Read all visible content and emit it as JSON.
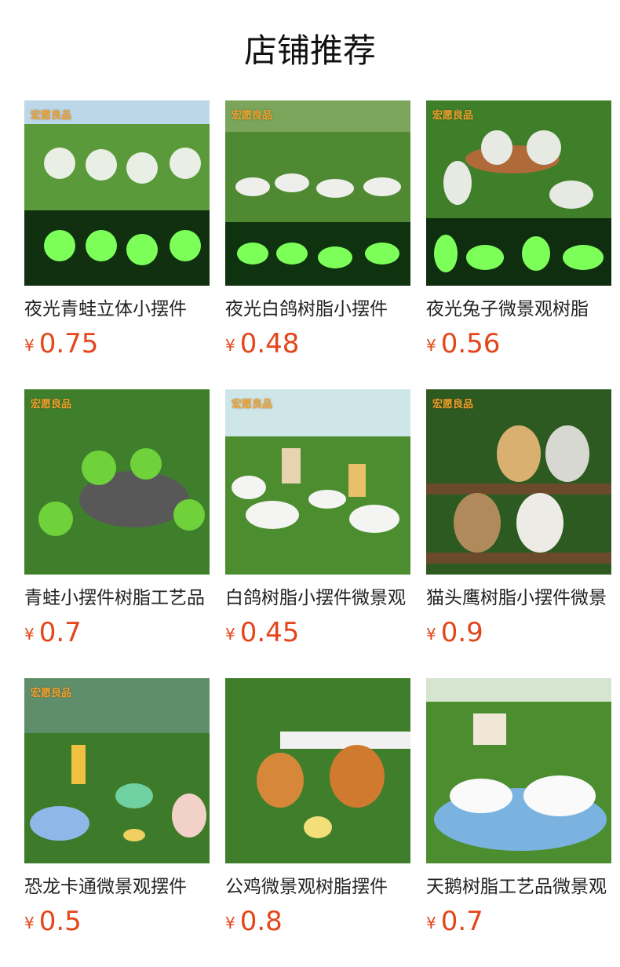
{
  "section_title": "店铺推荐",
  "currency_symbol": "¥",
  "products": [
    {
      "name": "夜光青蛙立体小摆件",
      "price": "0.75",
      "image_icon": "glow-frog-figurines-image",
      "brand": "宏愿良品"
    },
    {
      "name": "夜光白鸽树脂小摆件",
      "price": "0.48",
      "image_icon": "glow-dove-figurines-image",
      "brand": "宏愿良品"
    },
    {
      "name": "夜光兔子微景观树脂",
      "price": "0.56",
      "image_icon": "glow-rabbit-figurines-image",
      "brand": "宏愿良品"
    },
    {
      "name": "青蛙小摆件树脂工艺品",
      "price": "0.7",
      "image_icon": "frog-figurines-image",
      "brand": "宏愿良品"
    },
    {
      "name": "白鸽树脂小摆件微景观",
      "price": "0.45",
      "image_icon": "dove-windmill-image",
      "brand": "宏愿良品"
    },
    {
      "name": "猫头鹰树脂小摆件微景",
      "price": "0.9",
      "image_icon": "owl-figurines-image",
      "brand": "宏愿良品"
    },
    {
      "name": "恐龙卡通微景观摆件",
      "price": "0.5",
      "image_icon": "dinosaur-figurines-image",
      "brand": "宏愿良品"
    },
    {
      "name": "公鸡微景观树脂摆件",
      "price": "0.8",
      "image_icon": "rooster-figurines-image",
      "brand": ""
    },
    {
      "name": "天鹅树脂工艺品微景观",
      "price": "0.7",
      "image_icon": "swan-figurines-image",
      "brand": ""
    }
  ],
  "colors": {
    "price": "#e4461a",
    "title": "#111111"
  }
}
